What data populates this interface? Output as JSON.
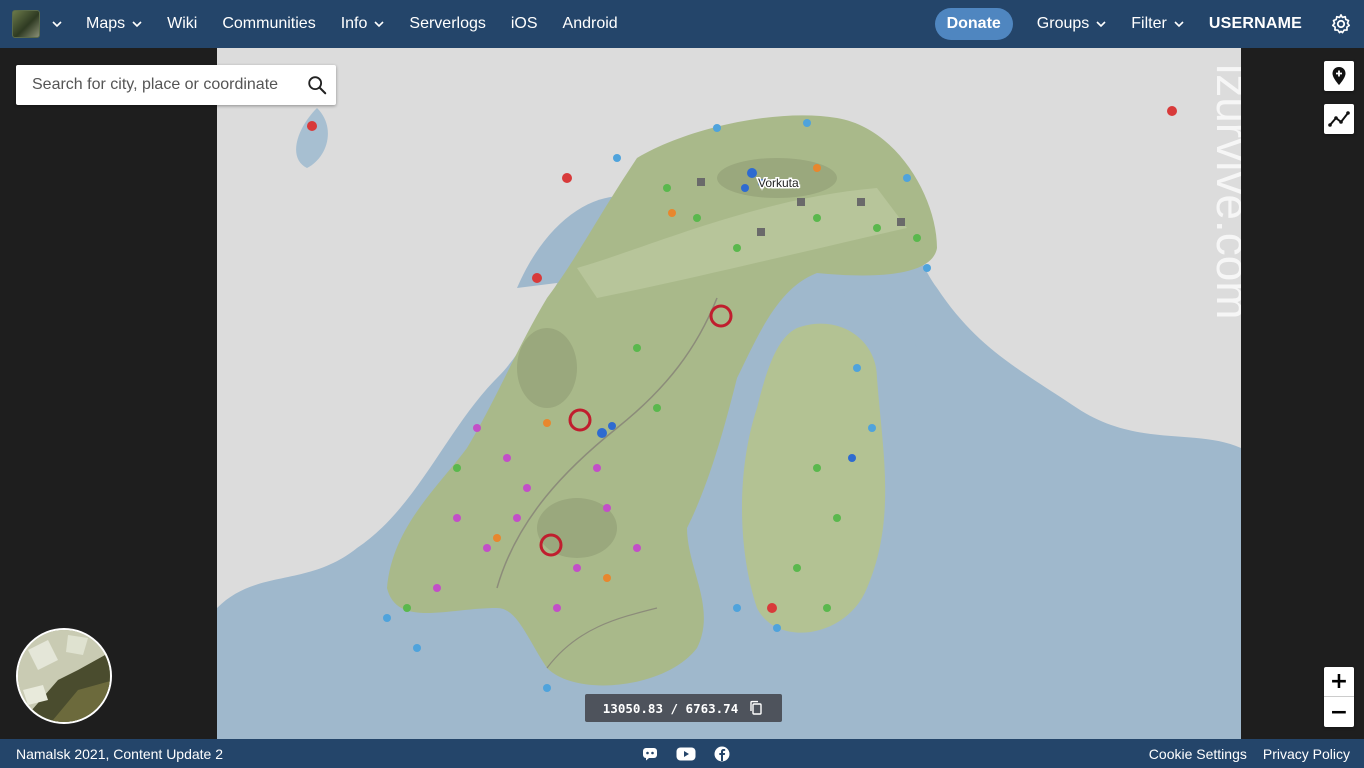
{
  "nav": {
    "items": [
      {
        "label": "Maps",
        "dropdown": true
      },
      {
        "label": "Wiki",
        "dropdown": false
      },
      {
        "label": "Communities",
        "dropdown": false
      },
      {
        "label": "Info",
        "dropdown": true
      },
      {
        "label": "Serverlogs",
        "dropdown": false
      },
      {
        "label": "iOS",
        "dropdown": false
      },
      {
        "label": "Android",
        "dropdown": false
      }
    ],
    "donate": "Donate",
    "groups": "Groups",
    "filter": "Filter",
    "username": "USERNAME"
  },
  "search": {
    "placeholder": "Search for city, place or coordinate"
  },
  "map": {
    "city_label": "Vorkuta",
    "watermark": "izurvive.com",
    "sea_color": "#9fb8cc",
    "land_color": "#a9b98a",
    "snow_color": "#dcdcdc"
  },
  "coords": {
    "text": "13050.83 / 6763.74"
  },
  "zoom": {
    "in": "+",
    "out": "−"
  },
  "footer": {
    "version": "Namalsk 2021, Content Update 2",
    "cookie": "Cookie Settings",
    "privacy": "Privacy Policy"
  },
  "icons": [
    "app-logo",
    "chevron-down-icon",
    "gear-icon",
    "search-icon",
    "add-marker-icon",
    "measure-icon",
    "copy-icon",
    "discord-icon",
    "youtube-icon",
    "facebook-icon"
  ]
}
